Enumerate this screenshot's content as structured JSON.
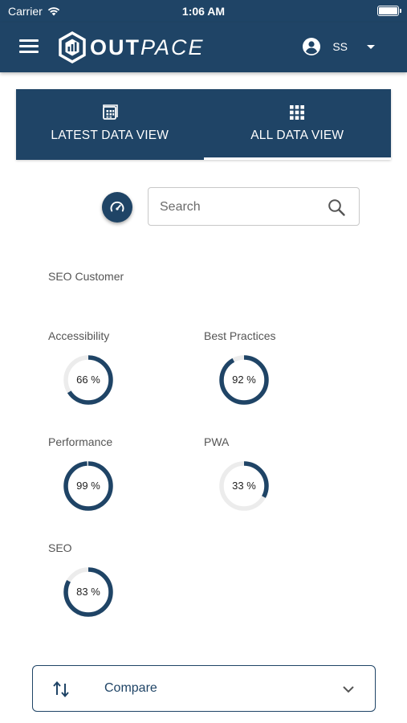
{
  "status_bar": {
    "carrier": "Carrier",
    "time": "1:06 AM"
  },
  "header": {
    "brand_part1": "OUT",
    "brand_part2": "PACE",
    "user_initials": "SS"
  },
  "tabs": [
    {
      "label": "LATEST DATA VIEW",
      "icon": "calendar-grid-icon",
      "active": false
    },
    {
      "label": "ALL DATA VIEW",
      "icon": "apps-grid-icon",
      "active": true
    }
  ],
  "search": {
    "placeholder": "Search",
    "value": ""
  },
  "customer": "SEO Customer",
  "metrics": [
    {
      "label": "Accessibility",
      "value": 66,
      "display": "66 %"
    },
    {
      "label": "Best Practices",
      "value": 92,
      "display": "92 %"
    },
    {
      "label": "Performance",
      "value": 99,
      "display": "99 %"
    },
    {
      "label": "PWA",
      "value": 33,
      "display": "33 %"
    },
    {
      "label": "SEO",
      "value": 83,
      "display": "83 %"
    }
  ],
  "compare": {
    "label": "Compare"
  },
  "colors": {
    "brand": "#1f4466",
    "track": "#ececec",
    "text": "#555555"
  }
}
